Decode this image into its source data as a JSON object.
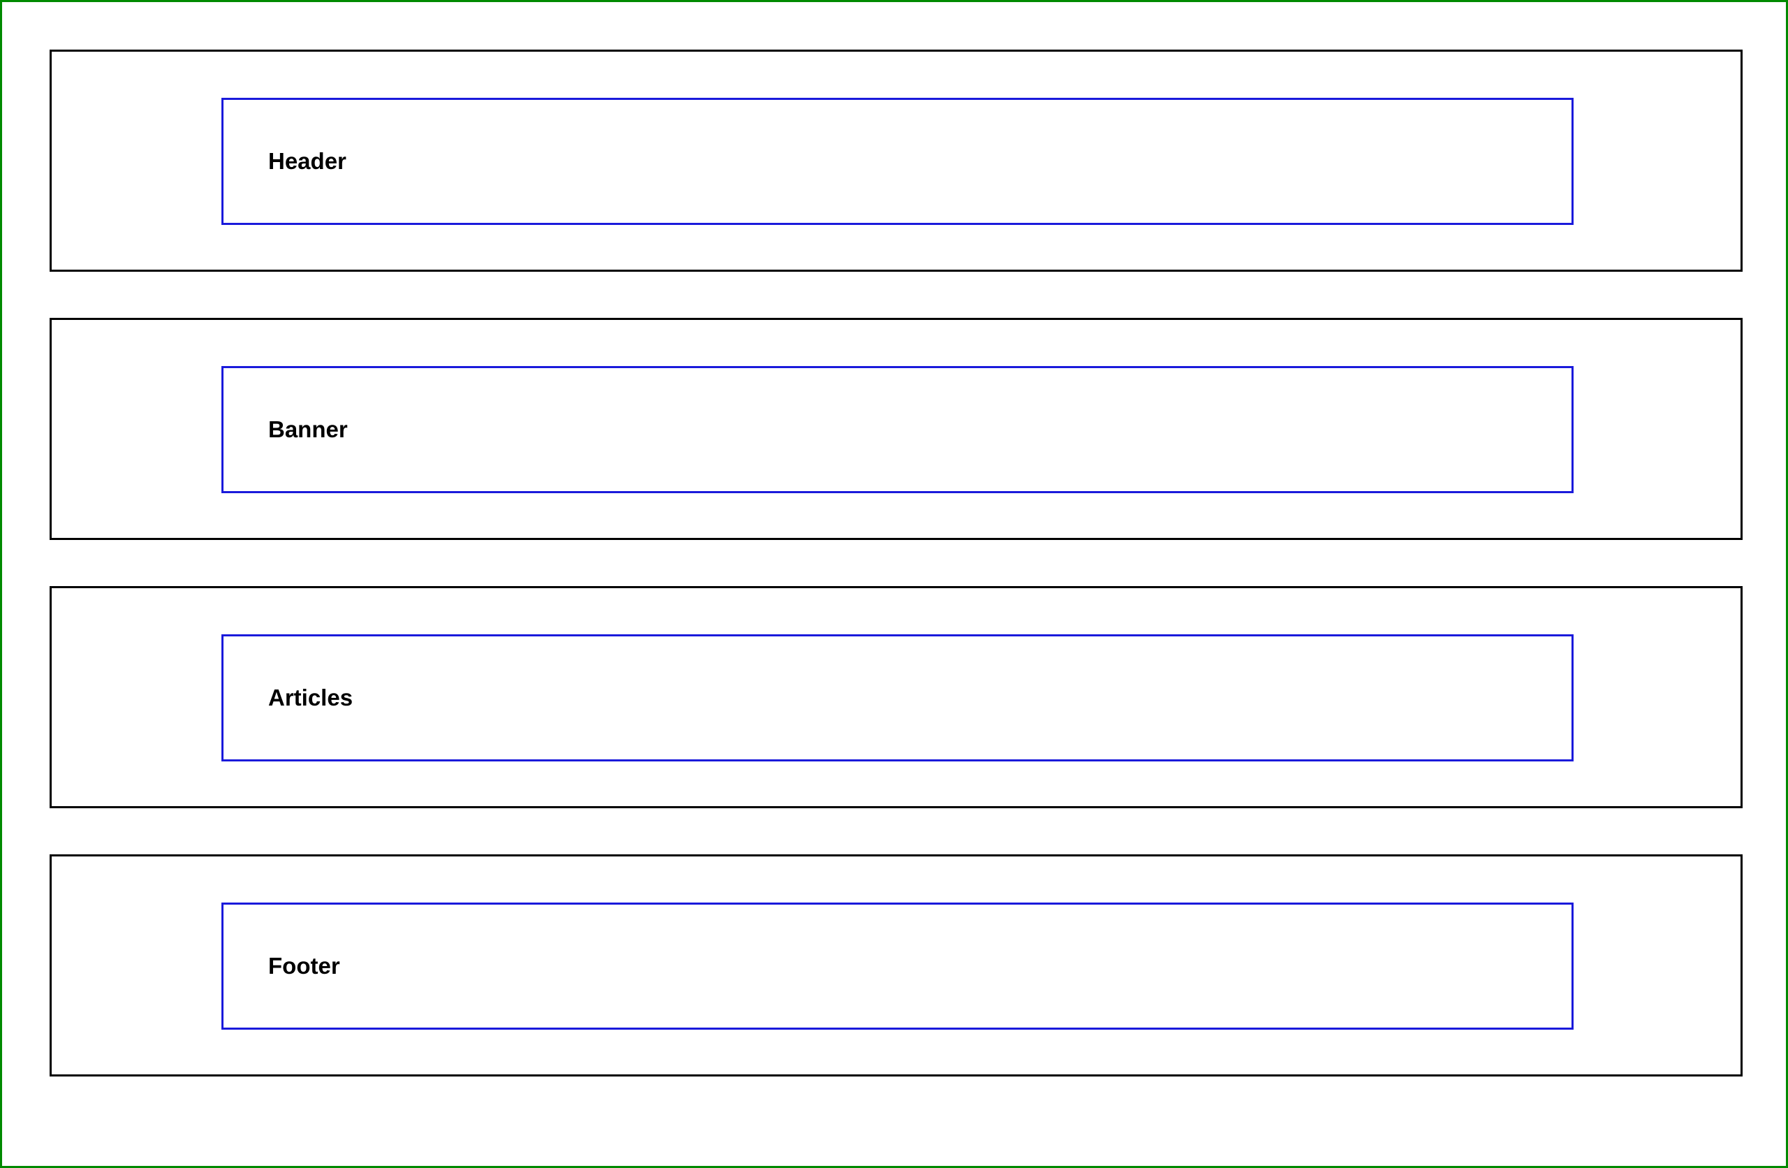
{
  "colors": {
    "page_border": "#008a00",
    "section_border": "#000000",
    "inner_border": "#1a1adb",
    "text": "#000000",
    "background": "#ffffff"
  },
  "sections": [
    {
      "label": "Header"
    },
    {
      "label": "Banner"
    },
    {
      "label": "Articles"
    },
    {
      "label": "Footer"
    }
  ]
}
